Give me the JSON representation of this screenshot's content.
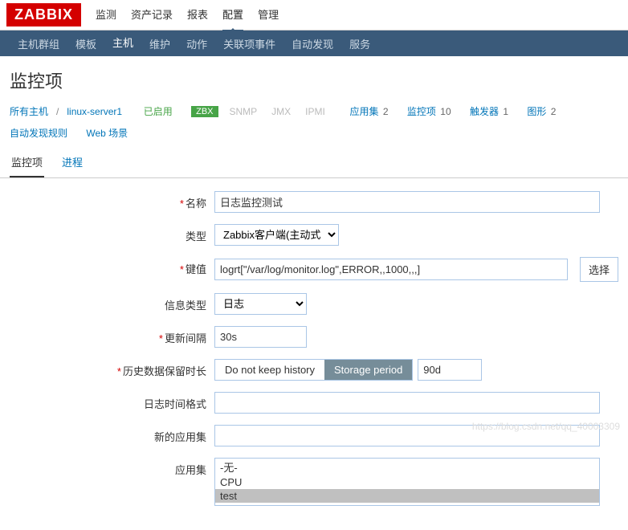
{
  "app": {
    "logo": "ZABBIX"
  },
  "topnav": {
    "items": [
      "监测",
      "资产记录",
      "报表",
      "配置",
      "管理"
    ],
    "active": 3
  },
  "subnav": {
    "items": [
      "主机群组",
      "模板",
      "主机",
      "维护",
      "动作",
      "关联项事件",
      "自动发现",
      "服务"
    ],
    "active": 2
  },
  "pageTitle": "监控项",
  "breadcrumb": {
    "allHosts": "所有主机",
    "host": "linux-server1",
    "enabled": "已启用",
    "badges": {
      "zbx": "ZBX",
      "snmp": "SNMP",
      "jmx": "JMX",
      "ipmi": "IPMI"
    },
    "links": [
      {
        "label": "应用集",
        "count": "2"
      },
      {
        "label": "监控项",
        "count": "10"
      },
      {
        "label": "触发器",
        "count": "1"
      },
      {
        "label": "图形",
        "count": "2"
      },
      {
        "label": "自动发现规则",
        "count": ""
      },
      {
        "label": "Web 场景",
        "count": ""
      }
    ]
  },
  "tabs": {
    "items": [
      "监控项",
      "进程"
    ],
    "active": 0
  },
  "form": {
    "name": {
      "label": "名称",
      "value": "日志监控测试"
    },
    "type": {
      "label": "类型",
      "value": "Zabbix客户端(主动式)"
    },
    "key": {
      "label": "键值",
      "value": "logrt[\"/var/log/monitor.log\",ERROR,,1000,,,]",
      "select": "选择"
    },
    "infoType": {
      "label": "信息类型",
      "value": "日志"
    },
    "interval": {
      "label": "更新间隔",
      "value": "30s"
    },
    "history": {
      "label": "历史数据保留时长",
      "opt1": "Do not keep history",
      "opt2": "Storage period",
      "value": "90d"
    },
    "logFormat": {
      "label": "日志时间格式",
      "value": ""
    },
    "newApp": {
      "label": "新的应用集",
      "value": ""
    },
    "appSet": {
      "label": "应用集",
      "options": [
        "-无-",
        "CPU",
        "test"
      ],
      "selected": 2
    }
  },
  "watermark": "https://blog.csdn.net/qq_40003309"
}
